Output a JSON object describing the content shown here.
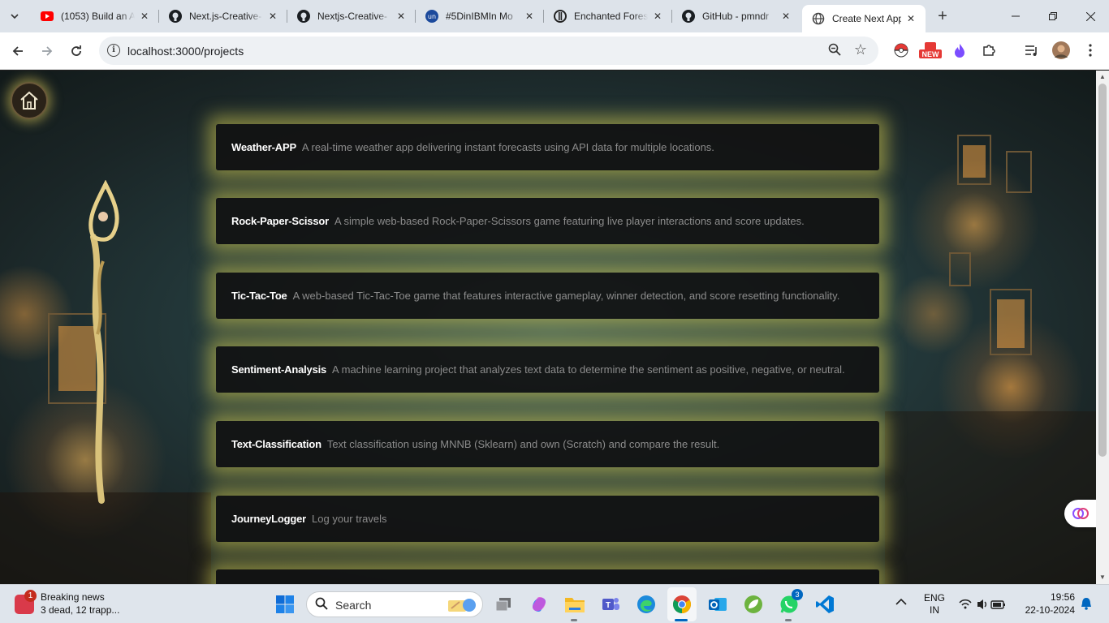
{
  "browser": {
    "tabs": [
      {
        "title": "(1053) Build an A",
        "icon": "youtube-icon",
        "active": false
      },
      {
        "title": "Next.js-Creative-",
        "icon": "github-icon",
        "active": false
      },
      {
        "title": "Nextjs-Creative-",
        "icon": "github-icon",
        "active": false
      },
      {
        "title": "#5DinIBMIn Mo",
        "icon": "unstop-icon",
        "active": false
      },
      {
        "title": "Enchanted Fores",
        "icon": "pen-nib-icon",
        "active": false
      },
      {
        "title": "GitHub - pmndr",
        "icon": "github-icon",
        "active": false
      },
      {
        "title": "Create Next App",
        "icon": "globe-icon",
        "active": true
      }
    ],
    "url": "localhost:3000/projects",
    "extension_badge": "NEW"
  },
  "page": {
    "projects": [
      {
        "name": "Weather-APP",
        "description": "A real-time weather app delivering instant forecasts using API data for multiple locations."
      },
      {
        "name": "Rock-Paper-Scissor",
        "description": "A simple web-based Rock-Paper-Scissors game featuring live player interactions and score updates."
      },
      {
        "name": "Tic-Tac-Toe",
        "description": "A web-based Tic-Tac-Toe game that features interactive gameplay, winner detection, and score resetting functionality."
      },
      {
        "name": "Sentiment-Analysis",
        "description": "A machine learning project that analyzes text data to determine the sentiment as positive, negative, or neutral."
      },
      {
        "name": "Text-Classification",
        "description": "Text classification using MNNB (Sklearn) and own (Scratch) and compare the result."
      },
      {
        "name": "JourneyLogger",
        "description": "Log your travels"
      },
      {
        "name": "",
        "description": ""
      }
    ]
  },
  "taskbar": {
    "news": {
      "badge": "1",
      "title": "Breaking news",
      "subtitle": "3 dead, 12 trapp..."
    },
    "search_placeholder": "Search",
    "whatsapp_badge": "3",
    "language": "ENG",
    "region": "IN",
    "time": "19:56",
    "date": "22-10-2024"
  },
  "colors": {
    "card_glow": "#d7cd50",
    "card_bg": "#121212",
    "tabstrip": "#dde3ea",
    "taskbar": "#dfe5ec"
  }
}
